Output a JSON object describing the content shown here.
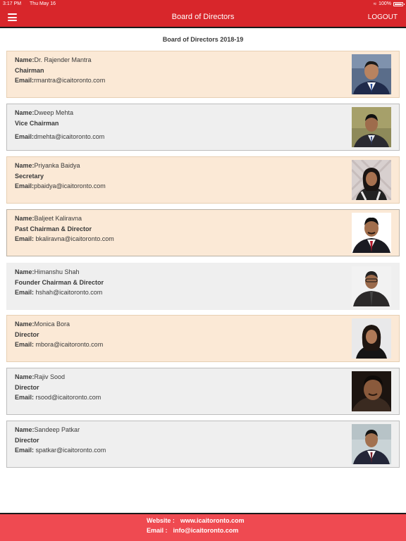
{
  "status_bar": {
    "time": "3:17 PM",
    "date": "Thu May 16",
    "battery": "100%"
  },
  "nav": {
    "title": "Board of Directors",
    "logout_label": "LOGOUT"
  },
  "heading": "Board of Directors 2018-19",
  "labels": {
    "name": "Name:",
    "email": "Email:"
  },
  "members": [
    {
      "name": "Dr. Rajender Mantra",
      "title": "Chairman",
      "email": "rmantra@icaitoronto.com"
    },
    {
      "name": "Dweep Mehta",
      "title": "Vice Chairman",
      "email": "dmehta@icaitoronto.com"
    },
    {
      "name": "Priyanka Baidya",
      "title": "Secretary",
      "email": "pbaidya@icaitoronto.com"
    },
    {
      "name": "Baljeet Kaliravna",
      "title": "Past Chairman & Director",
      "email": " bkaliravna@icaitoronto.com"
    },
    {
      "name": "Himanshu Shah",
      "title": "Founder Chairman & Director",
      "email": " hshah@icaitoronto.com"
    },
    {
      "name": "Monica Bora",
      "title": "Director",
      "email": " mbora@icaitoronto.com"
    },
    {
      "name": "Rajiv Sood",
      "title": "Director",
      "email": " rsood@icaitoronto.com"
    },
    {
      "name": "Sandeep Patkar",
      "title": "Director",
      "email": " spatkar@icaitoronto.com"
    }
  ],
  "footer": {
    "website_label": "Website :",
    "website": "www.icaitoronto.com",
    "email_label": "Email :",
    "email": "info@icaitoronto.com"
  }
}
